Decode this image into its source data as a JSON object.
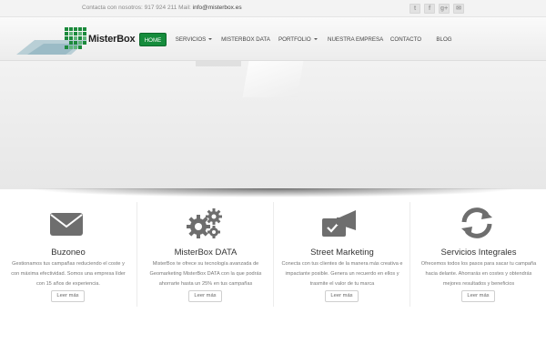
{
  "topbar": {
    "contact_text": "Contacta con nosotros: 917 924 211 Mail: ",
    "email": "info@misterbox.es",
    "social": [
      {
        "icon": "twitter-icon",
        "glyph": "t"
      },
      {
        "icon": "facebook-icon",
        "glyph": "f"
      },
      {
        "icon": "google-plus-icon",
        "glyph": "g+"
      },
      {
        "icon": "email-icon",
        "glyph": "✉"
      }
    ]
  },
  "header": {
    "logo_text": "MisterBox",
    "nav": [
      {
        "label": "HOME",
        "active": true,
        "dropdown": false
      },
      {
        "label": "SERVICIOS",
        "active": false,
        "dropdown": true
      },
      {
        "label": "MISTERBOX DATA",
        "active": false,
        "dropdown": false
      },
      {
        "label": "PORTFOLIO",
        "active": false,
        "dropdown": true
      },
      {
        "label": "NUESTRA EMPRESA",
        "active": false,
        "dropdown": false
      },
      {
        "label": "CONTACTO",
        "active": false,
        "dropdown": false
      },
      {
        "label": "BLOG",
        "active": false,
        "dropdown": false
      }
    ]
  },
  "colors": {
    "accent": "#168c3c",
    "icon_gray": "#6e6e6e"
  },
  "services": [
    {
      "icon": "envelope-icon",
      "title": "Buzoneo",
      "description": "Gestionamos tus campañas reduciendo el coste y con máxima efectividad. Somos una empresa líder con 15 años de experiencia.",
      "button": "Leer más"
    },
    {
      "icon": "gears-icon",
      "title": "MisterBox DATA",
      "description": "MisterBox te ofrece su tecnología avanzada de Geomarketing MisterBox DATA con la que podrás ahorrarte hasta un 25% en tus campañas",
      "button": "Leer más"
    },
    {
      "icon": "megaphone-icon",
      "title": "Street Marketing",
      "description": "Conecta con tus clientes de la manera más creativa e impactante posible. Genera un recuerdo en ellos y trasmite el valor de tu marca",
      "button": "Leer más"
    },
    {
      "icon": "refresh-icon",
      "title": "Servicios Integrales",
      "description": "Ofrecemos todos los pasos para sacar tu campaña hacia delante. Ahorrarás en costes y obtendrás mejores resultados y beneficios",
      "button": "Leer más"
    }
  ]
}
